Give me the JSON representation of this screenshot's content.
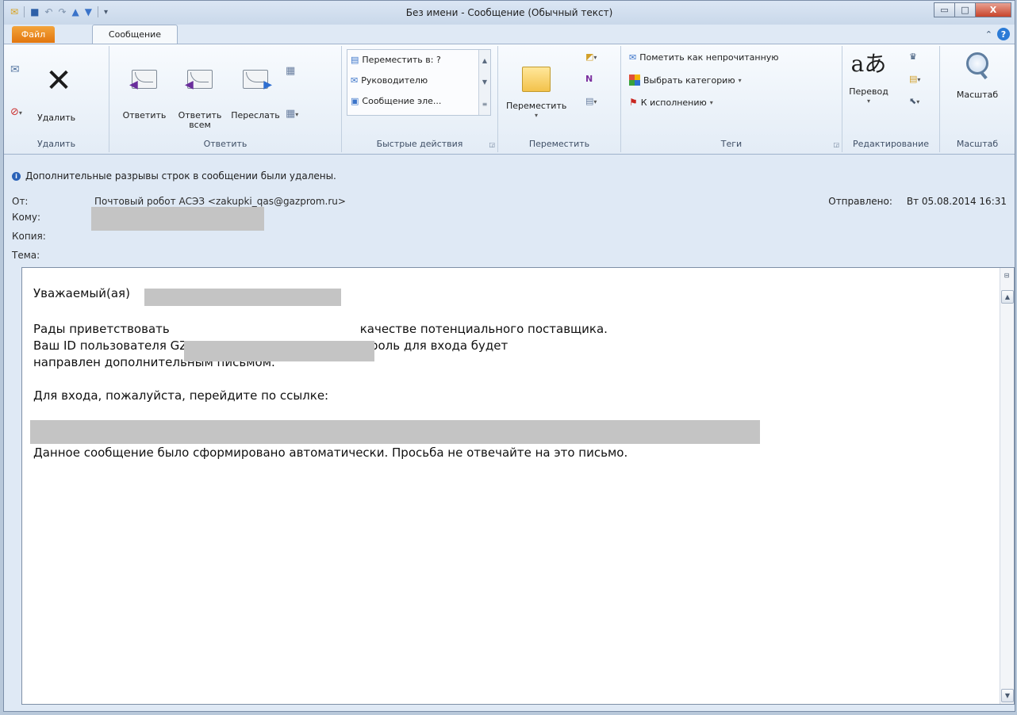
{
  "window": {
    "title": "Без имени  -  Сообщение (Обычный текст)",
    "controls": {
      "minimize": "▭",
      "maximize": "□",
      "close": "X"
    }
  },
  "quick_access": {
    "icons": [
      "mail-icon",
      "save-icon",
      "undo-icon",
      "redo-icon",
      "up-icon",
      "down-icon",
      "customize-icon"
    ]
  },
  "tabs": {
    "file": "Файл",
    "message": "Сообщение"
  },
  "ribbon": {
    "delete_group": {
      "label": "Удалить",
      "delete_button": "Удалить"
    },
    "reply_group": {
      "label": "Ответить",
      "reply": "Ответить",
      "reply_all": "Ответить всем",
      "forward": "Переслать"
    },
    "quick_steps": {
      "label": "Быстрые действия",
      "items": [
        "Переместить в: ?",
        "Руководителю",
        "Сообщение эле..."
      ]
    },
    "move_group": {
      "label": "Переместить",
      "move_button": "Переместить"
    },
    "tags_group": {
      "label": "Теги",
      "mark_unread": "Пометить как непрочитанную",
      "categorize": "Выбрать категорию",
      "follow_up": "К исполнению"
    },
    "editing_group": {
      "label": "Редактирование",
      "translate": "Перевод"
    },
    "zoom_group": {
      "label": "Масштаб",
      "zoom_button": "Масштаб"
    }
  },
  "infobar": {
    "text": "Дополнительные разрывы строк в сообщении были удалены."
  },
  "headers": {
    "from_label": "От:",
    "from_value": "Почтовый робот АСЭЗ <zakupki_qas@gazprom.ru>",
    "to_label": "Кому:",
    "cc_label": "Копия:",
    "subject_label": "Тема:",
    "sent_label": "Отправлено:",
    "sent_value": "Вт 05.08.2014 16:31"
  },
  "body": {
    "greeting": "Уважаемый(ая)",
    "line1_start": "Рады приветствовать",
    "line1_end": "качестве потенциального поставщика.",
    "line2": "Ваш ID пользователя GZP0000048   сгенерирован. Пароль для входа будет",
    "line3": "направлен дополнительным письмом.",
    "line4": "Для входа, пожалуйста, перейдите по ссылке:",
    "line5": "Данное сообщение было сформировано автоматически. Просьба не отвечайте на это письмо."
  },
  "colors": {
    "accent": "#e2760f",
    "ribbon_bg": "#e3ecf6",
    "window_bg": "#dfe9f5",
    "redaction": "#c4c4c4"
  }
}
